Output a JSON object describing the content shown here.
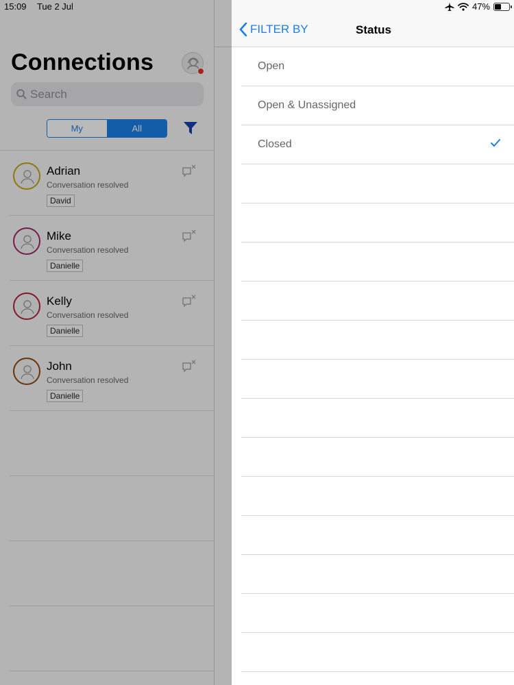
{
  "status_bar": {
    "time": "15:09",
    "date": "Tue 2 Jul",
    "battery": "47%",
    "battery_level": 0.47,
    "icons": [
      "airplane-icon",
      "wifi-icon",
      "battery-icon"
    ]
  },
  "connections": {
    "title": "Connections",
    "search_placeholder": "Search",
    "segments": [
      "My",
      "All"
    ],
    "selected_segment": "All",
    "items": [
      {
        "name": "Adrian",
        "preview": "Conversation resolved",
        "agent": "David",
        "ring_color": "#c8a415"
      },
      {
        "name": "Mike",
        "preview": "Conversation resolved",
        "agent": "Danielle",
        "ring_color": "#9b2a6a"
      },
      {
        "name": "Kelly",
        "preview": "Conversation resolved",
        "agent": "Danielle",
        "ring_color": "#b0243c"
      },
      {
        "name": "John",
        "preview": "Conversation resolved",
        "agent": "Danielle",
        "ring_color": "#8a4b12"
      }
    ]
  },
  "filter_panel": {
    "back_label": "FILTER BY",
    "title": "Status",
    "options": [
      {
        "label": "Open",
        "selected": false
      },
      {
        "label": "Open & Unassigned",
        "selected": false
      },
      {
        "label": "Closed",
        "selected": true
      }
    ],
    "accent_color": "#1a7fe6"
  }
}
